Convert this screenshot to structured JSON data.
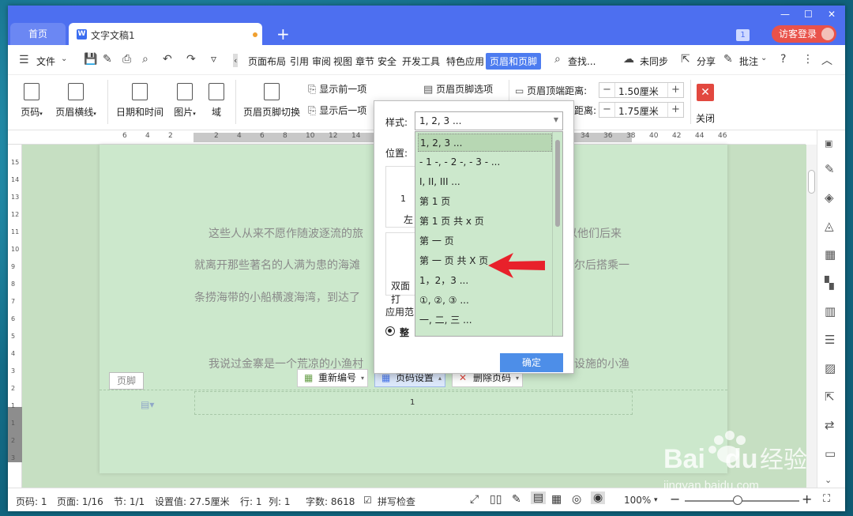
{
  "tabs": {
    "home": "首页",
    "doc": "文字文稿1"
  },
  "header": {
    "badge": "1",
    "login": "访客登录"
  },
  "menu": {
    "file": "文件",
    "items": [
      "页面布局",
      "引用",
      "审阅",
      "视图",
      "章节",
      "安全",
      "开发工具",
      "特色应用"
    ],
    "active": "页眉和页脚",
    "search": "查找...",
    "sync": "未同步",
    "share": "分享",
    "comment": "批注"
  },
  "ribbon": {
    "page_num": "页码",
    "header_line": "页眉横线",
    "datetime": "日期和时间",
    "picture": "图片",
    "field": "域",
    "switch": "页眉页脚切换",
    "show_prev": "显示前一项",
    "show_next": "显示后一项",
    "options": "页眉页脚选项",
    "top_dist_label": "页眉顶端距离:",
    "top_dist_value": "1.50厘米",
    "bottom_dist_label": "距离:",
    "bottom_dist_value": "1.75厘米",
    "close": "关闭"
  },
  "ruler": {
    "h": [
      "6",
      "4",
      "2",
      "",
      "2",
      "4",
      "6",
      "8",
      "10",
      "12",
      "14",
      "16",
      "18",
      "20",
      "22",
      "24",
      "26",
      "28",
      "30",
      "32",
      "34",
      "36",
      "38",
      "40",
      "42",
      "44",
      "46"
    ],
    "v": [
      "15",
      "14",
      "13",
      "12",
      "11",
      "10",
      "9",
      "8",
      "7",
      "6",
      "5",
      "4",
      "3",
      "2",
      "1",
      "1",
      "2",
      "3"
    ]
  },
  "document": {
    "lines": [
      "这些人从来不愿作随波逐流的旅",
      "以他们后来",
      "就离开那些著名的人满为患的海滩",
      "尔后搭乘一",
      "条捞海带的小船横渡海湾，到达了",
      "我说过金寨是一个荒凉的小渔村",
      "设施的小渔"
    ],
    "footer_label": "页脚",
    "page_number": "1"
  },
  "footer_toolbar": {
    "renumber": "重新编号",
    "page_setup": "页码设置",
    "delete": "删除页码"
  },
  "dialog": {
    "style_label": "样式:",
    "style_value": "1, 2, 3 ...",
    "position_label": "位置:",
    "left_label": "左",
    "double_label": "双面打",
    "apply_label": "应用范",
    "apply_opt": "整",
    "position_preview_num": "1",
    "options": [
      "1, 2, 3 ...",
      "- 1 -, - 2 -, - 3 - ...",
      "I, II, III ...",
      "第 1 页",
      "第 1 页 共 x 页",
      "第 一 页",
      "第 一 页 共 X 页",
      "1，2，3 ...",
      "①, ②, ③ ...",
      "一, 二, 三 ..."
    ],
    "ok": "确定"
  },
  "status": {
    "page": "页码: 1",
    "pages": "页面: 1/16",
    "section": "节: 1/1",
    "setting": "设置值: 27.5厘米",
    "row": "行: 1",
    "col": "列: 1",
    "words": "字数: 8618",
    "spell": "拼写检查",
    "zoom": "100%"
  },
  "watermark": {
    "brand": "Bai",
    "brand2": "du",
    "cn": "经验",
    "url": "jingyan.baidu.com"
  },
  "colors": {
    "titlebar": "#4d6ff0",
    "accent": "#4d7cf0",
    "doc_bg": "#cce8cc",
    "arrow": "#e8212b"
  }
}
